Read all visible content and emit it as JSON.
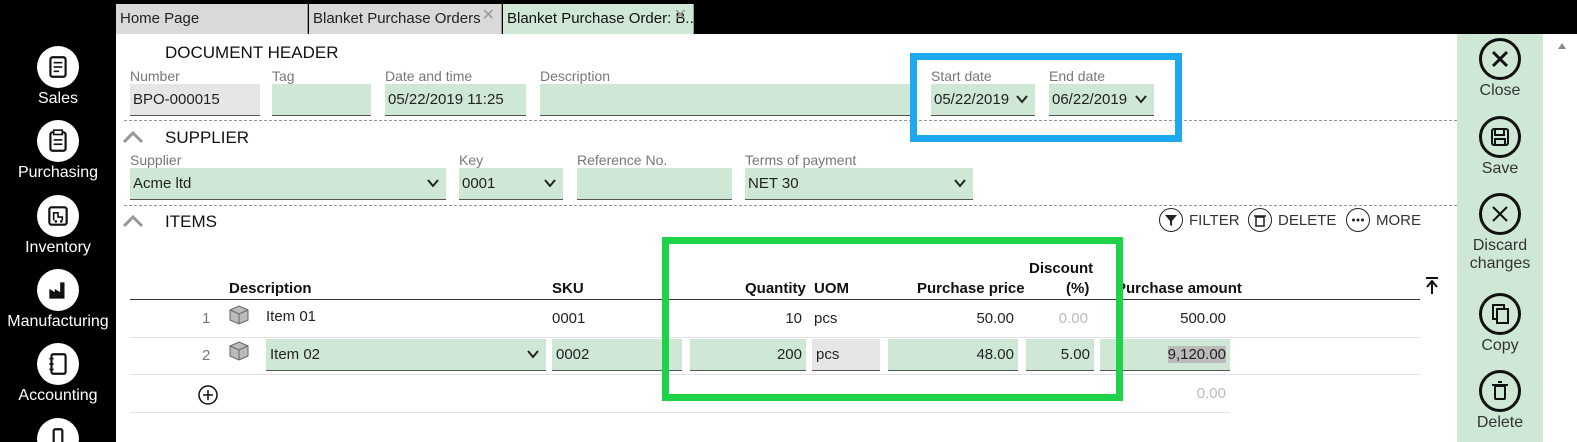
{
  "nav": {
    "items": [
      {
        "label": "Sales",
        "icon": "sales-icon"
      },
      {
        "label": "Purchasing",
        "icon": "purchasing-icon"
      },
      {
        "label": "Inventory",
        "icon": "inventory-icon"
      },
      {
        "label": "Manufacturing",
        "icon": "manufacturing-icon"
      },
      {
        "label": "Accounting",
        "icon": "accounting-icon"
      }
    ]
  },
  "tabs": [
    {
      "label": "Home Page",
      "closable": false
    },
    {
      "label": "Blanket Purchase Orders",
      "closable": true
    },
    {
      "label": "Blanket Purchase Order: B...",
      "closable": true,
      "active": true
    }
  ],
  "header": {
    "title": "DOCUMENT HEADER",
    "number_label": "Number",
    "number_value": "BPO-000015",
    "tag_label": "Tag",
    "tag_value": "",
    "datetime_label": "Date and time",
    "datetime_value": "05/22/2019 11:25",
    "description_label": "Description",
    "description_value": "",
    "start_label": "Start date",
    "start_value": "05/22/2019",
    "end_label": "End date",
    "end_value": "06/22/2019"
  },
  "supplier": {
    "title": "SUPPLIER",
    "supplier_label": "Supplier",
    "supplier_value": "Acme ltd",
    "key_label": "Key",
    "key_value": "0001",
    "ref_label": "Reference No.",
    "ref_value": "",
    "terms_label": "Terms of payment",
    "terms_value": "NET 30"
  },
  "items": {
    "title": "ITEMS",
    "filter_label": "FILTER",
    "delete_label": "DELETE",
    "more_label": "MORE",
    "columns": {
      "description": "Description",
      "sku": "SKU",
      "quantity": "Quantity",
      "uom": "UOM",
      "price": "Purchase price",
      "discount_line1": "Discount",
      "discount_line2": "(%)",
      "amount": "Purchase amount"
    },
    "rows": [
      {
        "num": "1",
        "description": "Item 01",
        "sku": "0001",
        "quantity": "10",
        "uom": "pcs",
        "price": "50.00",
        "discount": "0.00",
        "amount": "500.00"
      },
      {
        "num": "2",
        "description": "Item 02",
        "sku": "0002",
        "quantity": "200",
        "uom": "pcs",
        "price": "48.00",
        "discount": "5.00",
        "amount": "9,120.00"
      }
    ],
    "new_row_amount": "0.00"
  },
  "actions": [
    {
      "label": "Close",
      "icon": "close-icon"
    },
    {
      "label": "Save",
      "icon": "save-icon"
    },
    {
      "label": "Discard changes",
      "icon": "discard-icon"
    },
    {
      "label": "Copy",
      "icon": "copy-icon"
    },
    {
      "label": "Delete",
      "icon": "delete-icon"
    }
  ],
  "colors": {
    "field_bg": "#cfe8d6",
    "highlight_blue": "#1ea8f0",
    "highlight_green": "#1ed24a"
  }
}
